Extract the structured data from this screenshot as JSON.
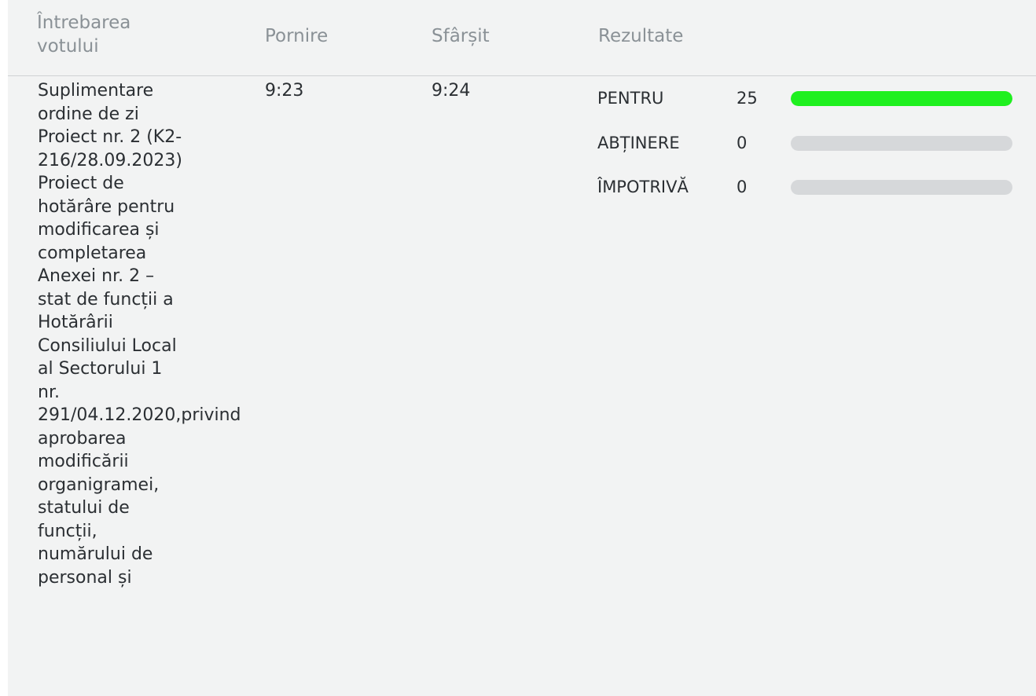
{
  "header": {
    "question_label": "Întrebarea votului",
    "start_label": "Pornire",
    "end_label": "Sfârșit",
    "results_label": "Rezultate"
  },
  "row": {
    "question": "Suplimentare\nordine de zi\nProiect nr. 2 (K2-\n216/28.09.2023)\nProiect de\nhotărâre pentru\nmodificarea și\ncompletarea\nAnexei nr. 2 –\nstat de funcții a\nHotărârii\nConsiliului Local\nal Sectorului 1\nnr.\n291/04.12.2020,privind\naprobarea\nmodificării\norganigramei,\nstatului de\nfuncții,\nnumărului de\npersonal și",
    "start": "9:23",
    "end": "9:24",
    "results": [
      {
        "label": "PENTRU",
        "count": "25",
        "fraction": 1.0,
        "color": "#1ff01f"
      },
      {
        "label": "ABȚINERE",
        "count": "0",
        "fraction": 0.0,
        "color": "#d6d8da"
      },
      {
        "label": "ÎMPOTRIVĂ",
        "count": "0",
        "fraction": 0.0,
        "color": "#d6d8da"
      }
    ]
  }
}
